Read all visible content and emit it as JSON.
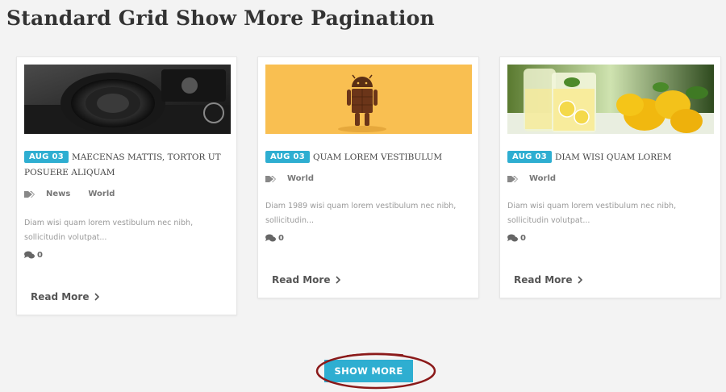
{
  "page": {
    "title": "Standard Grid Show More Pagination"
  },
  "colors": {
    "accent": "#2eaed1",
    "annotation": "#8b1a1a"
  },
  "cards": [
    {
      "image": "camera-photo",
      "date": "AUG 03",
      "title": "MAECENAS MATTIS, TORTOR UT POSUERE ALIQUAM",
      "tags": [
        "News",
        "World"
      ],
      "excerpt": "Diam wisi quam lorem vestibulum nec nibh, sollicitudin volutpat...",
      "comments": "0",
      "read_more": "Read More"
    },
    {
      "image": "android-figure-photo",
      "date": "AUG 03",
      "title": "QUAM LOREM VESTIBULUM",
      "tags": [
        "World"
      ],
      "excerpt": "Diam 1989 wisi quam lorem vestibulum nec nibh, sollicitudin...",
      "comments": "0",
      "read_more": "Read More"
    },
    {
      "image": "lemonade-photo",
      "date": "AUG 03",
      "title": "DIAM WISI QUAM LOREM",
      "tags": [
        "World"
      ],
      "excerpt": "Diam wisi quam lorem vestibulum nec nibh, sollicitudin volutpat...",
      "comments": "0",
      "read_more": "Read More"
    }
  ],
  "pagination": {
    "show_more_label": "SHOW MORE"
  }
}
